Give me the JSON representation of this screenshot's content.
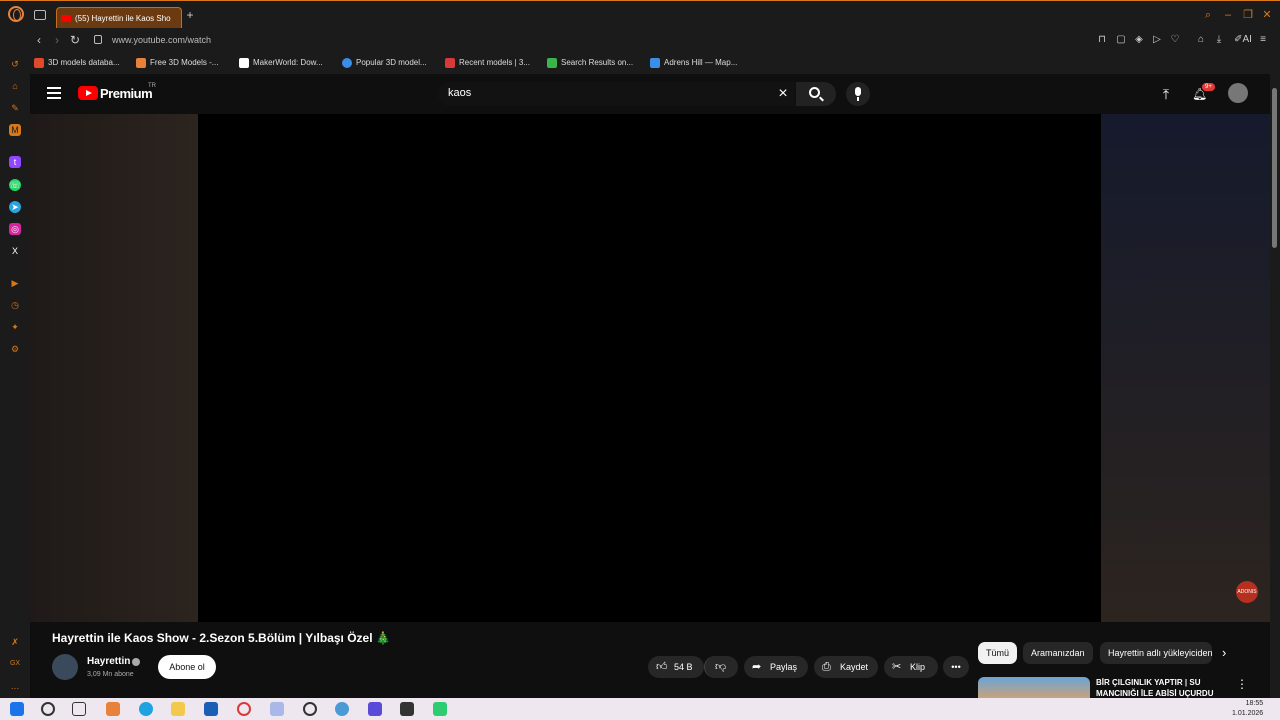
{
  "browser": {
    "tab_title": "(55) Hayrettin ile Kaos Sho",
    "url": "www.youtube.com/watch",
    "bookmarks": [
      {
        "label": "3D models databa...",
        "icon_color": "#e04a2a"
      },
      {
        "label": "Free 3D Models -...",
        "icon_color": "#e8823a"
      },
      {
        "label": "MakerWorld: Dow...",
        "icon_color": "#ffffff"
      },
      {
        "label": "Popular 3D model...",
        "icon_color": "#3a8ee8"
      },
      {
        "label": "Recent models | 3...",
        "icon_color": "#d83a3a"
      },
      {
        "label": "Search Results on...",
        "icon_color": "#3bb54a"
      },
      {
        "label": "Adrens Hill — Map...",
        "icon_color": "#3a8ee8"
      }
    ],
    "accent_color": "#d87818"
  },
  "youtube": {
    "logo_text": "Premium",
    "region": "TR",
    "search_query": "kaos",
    "notification_badge": "9+",
    "video": {
      "title": "Hayrettin ile Kaos Show - 2.Sezon 5.Bölüm | Yılbaşı Özel 🎄",
      "channel": "Hayrettin",
      "subscribers": "3,09 Mn abone",
      "subscribe_label": "Abone ol",
      "likes": "54 B",
      "share_label": "Paylaş",
      "save_label": "Kaydet",
      "clip_label": "Klip",
      "more_label": "•••"
    },
    "chips": [
      "Tümü",
      "Aramanızdan",
      "Hayrettin adlı yükleyiciden"
    ],
    "recommendation": {
      "title": "BİR ÇILGINLIK YAPTIR | SU MANCINIĞI İLE ABİSİ UÇURDU"
    },
    "floating_badge": "ADONIS"
  },
  "taskbar": {
    "time": "18:55",
    "date": "1.01.2026"
  }
}
